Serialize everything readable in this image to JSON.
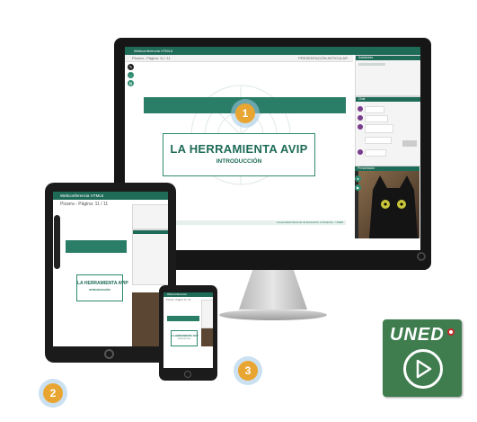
{
  "monitor": {
    "app_title": "Webconferencia HTML5",
    "page_label": "Pizarra - Página: 11 / 11",
    "top_right_label": "PRESENTACIÓN ARTICULAR",
    "slide_title": "LA HERRAMIENTA AVIP",
    "slide_subtitle": "INTRODUCCIÓN",
    "footer_text": "Universidad Nacional de Educación a Distancia · UNED",
    "panel_participants": "Asistentes",
    "panel_chat": "Chat",
    "panel_camera": "Presentador"
  },
  "tablet": {
    "app_title": "Webconferencia HTML5",
    "page_label": "Pizarra - Página: 11 / 11",
    "slide_title": "LA HERRAMIENTA AVIP",
    "slide_subtitle": "INTRODUCCIÓN"
  },
  "phone": {
    "app_title": "Webconferencia",
    "page_label": "Pizarra - Página: 11 / 11",
    "slide_title": "LA HERRAMIENTA AVIP",
    "slide_subtitle": "INTRODUCCIÓN"
  },
  "badges": [
    "1",
    "2",
    "3"
  ],
  "logo": {
    "text": "UNED",
    "bg": "#3f7d4f"
  },
  "colors": {
    "accent": "#1e6b57",
    "badge": "#e9a531",
    "badge_glow": "#a0c8e6"
  }
}
